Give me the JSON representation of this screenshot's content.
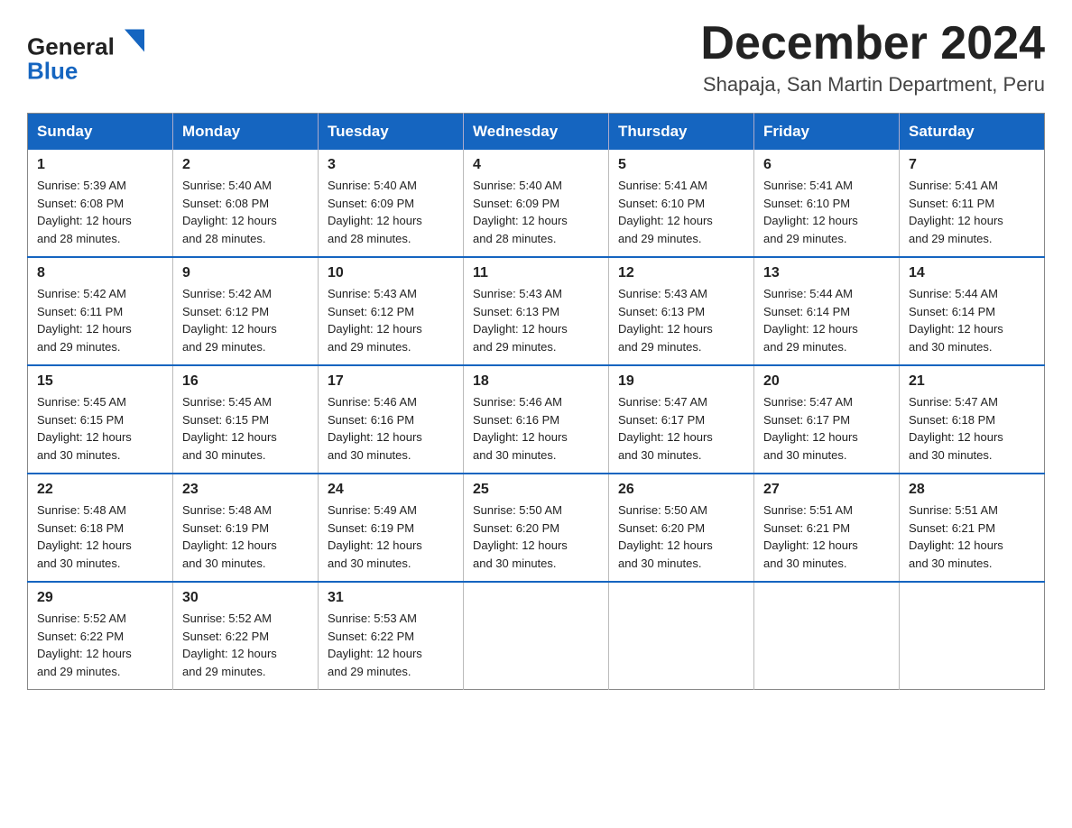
{
  "header": {
    "logo_general": "General",
    "logo_blue": "Blue",
    "month_title": "December 2024",
    "location": "Shapaja, San Martin Department, Peru"
  },
  "weekdays": [
    "Sunday",
    "Monday",
    "Tuesday",
    "Wednesday",
    "Thursday",
    "Friday",
    "Saturday"
  ],
  "weeks": [
    [
      {
        "day": "1",
        "sunrise": "5:39 AM",
        "sunset": "6:08 PM",
        "daylight": "12 hours and 28 minutes."
      },
      {
        "day": "2",
        "sunrise": "5:40 AM",
        "sunset": "6:08 PM",
        "daylight": "12 hours and 28 minutes."
      },
      {
        "day": "3",
        "sunrise": "5:40 AM",
        "sunset": "6:09 PM",
        "daylight": "12 hours and 28 minutes."
      },
      {
        "day": "4",
        "sunrise": "5:40 AM",
        "sunset": "6:09 PM",
        "daylight": "12 hours and 28 minutes."
      },
      {
        "day": "5",
        "sunrise": "5:41 AM",
        "sunset": "6:10 PM",
        "daylight": "12 hours and 29 minutes."
      },
      {
        "day": "6",
        "sunrise": "5:41 AM",
        "sunset": "6:10 PM",
        "daylight": "12 hours and 29 minutes."
      },
      {
        "day": "7",
        "sunrise": "5:41 AM",
        "sunset": "6:11 PM",
        "daylight": "12 hours and 29 minutes."
      }
    ],
    [
      {
        "day": "8",
        "sunrise": "5:42 AM",
        "sunset": "6:11 PM",
        "daylight": "12 hours and 29 minutes."
      },
      {
        "day": "9",
        "sunrise": "5:42 AM",
        "sunset": "6:12 PM",
        "daylight": "12 hours and 29 minutes."
      },
      {
        "day": "10",
        "sunrise": "5:43 AM",
        "sunset": "6:12 PM",
        "daylight": "12 hours and 29 minutes."
      },
      {
        "day": "11",
        "sunrise": "5:43 AM",
        "sunset": "6:13 PM",
        "daylight": "12 hours and 29 minutes."
      },
      {
        "day": "12",
        "sunrise": "5:43 AM",
        "sunset": "6:13 PM",
        "daylight": "12 hours and 29 minutes."
      },
      {
        "day": "13",
        "sunrise": "5:44 AM",
        "sunset": "6:14 PM",
        "daylight": "12 hours and 29 minutes."
      },
      {
        "day": "14",
        "sunrise": "5:44 AM",
        "sunset": "6:14 PM",
        "daylight": "12 hours and 30 minutes."
      }
    ],
    [
      {
        "day": "15",
        "sunrise": "5:45 AM",
        "sunset": "6:15 PM",
        "daylight": "12 hours and 30 minutes."
      },
      {
        "day": "16",
        "sunrise": "5:45 AM",
        "sunset": "6:15 PM",
        "daylight": "12 hours and 30 minutes."
      },
      {
        "day": "17",
        "sunrise": "5:46 AM",
        "sunset": "6:16 PM",
        "daylight": "12 hours and 30 minutes."
      },
      {
        "day": "18",
        "sunrise": "5:46 AM",
        "sunset": "6:16 PM",
        "daylight": "12 hours and 30 minutes."
      },
      {
        "day": "19",
        "sunrise": "5:47 AM",
        "sunset": "6:17 PM",
        "daylight": "12 hours and 30 minutes."
      },
      {
        "day": "20",
        "sunrise": "5:47 AM",
        "sunset": "6:17 PM",
        "daylight": "12 hours and 30 minutes."
      },
      {
        "day": "21",
        "sunrise": "5:47 AM",
        "sunset": "6:18 PM",
        "daylight": "12 hours and 30 minutes."
      }
    ],
    [
      {
        "day": "22",
        "sunrise": "5:48 AM",
        "sunset": "6:18 PM",
        "daylight": "12 hours and 30 minutes."
      },
      {
        "day": "23",
        "sunrise": "5:48 AM",
        "sunset": "6:19 PM",
        "daylight": "12 hours and 30 minutes."
      },
      {
        "day": "24",
        "sunrise": "5:49 AM",
        "sunset": "6:19 PM",
        "daylight": "12 hours and 30 minutes."
      },
      {
        "day": "25",
        "sunrise": "5:50 AM",
        "sunset": "6:20 PM",
        "daylight": "12 hours and 30 minutes."
      },
      {
        "day": "26",
        "sunrise": "5:50 AM",
        "sunset": "6:20 PM",
        "daylight": "12 hours and 30 minutes."
      },
      {
        "day": "27",
        "sunrise": "5:51 AM",
        "sunset": "6:21 PM",
        "daylight": "12 hours and 30 minutes."
      },
      {
        "day": "28",
        "sunrise": "5:51 AM",
        "sunset": "6:21 PM",
        "daylight": "12 hours and 30 minutes."
      }
    ],
    [
      {
        "day": "29",
        "sunrise": "5:52 AM",
        "sunset": "6:22 PM",
        "daylight": "12 hours and 29 minutes."
      },
      {
        "day": "30",
        "sunrise": "5:52 AM",
        "sunset": "6:22 PM",
        "daylight": "12 hours and 29 minutes."
      },
      {
        "day": "31",
        "sunrise": "5:53 AM",
        "sunset": "6:22 PM",
        "daylight": "12 hours and 29 minutes."
      },
      null,
      null,
      null,
      null
    ]
  ],
  "labels": {
    "sunrise": "Sunrise:",
    "sunset": "Sunset:",
    "daylight": "Daylight:"
  }
}
